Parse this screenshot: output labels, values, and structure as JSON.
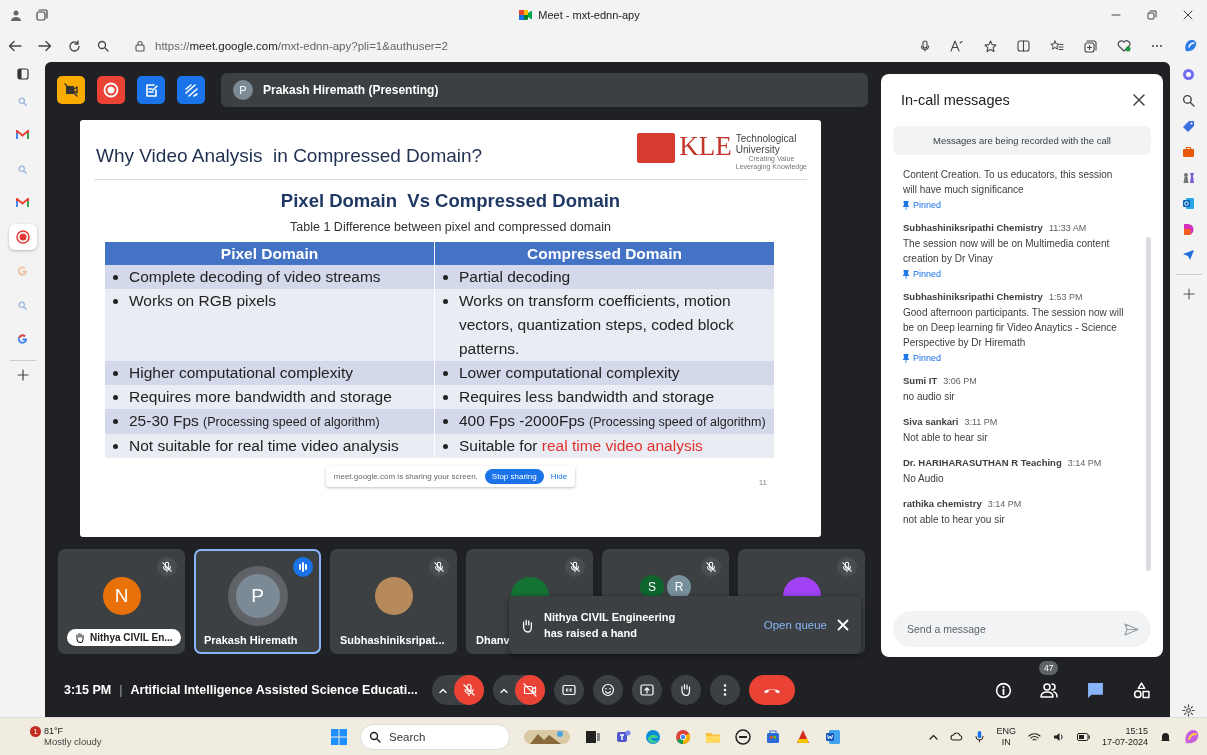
{
  "browser": {
    "window_title": "Meet - mxt-ednn-apy",
    "url": "https://**meet.google.com**/mxt-ednn-apy?pli=1&authuser=2",
    "vertical_tabs": [
      {
        "kind": "search",
        "selected": false
      },
      {
        "kind": "mail",
        "selected": false
      },
      {
        "kind": "search",
        "selected": false
      },
      {
        "kind": "mail",
        "selected": false
      },
      {
        "kind": "record",
        "selected": true
      },
      {
        "kind": "google-faded",
        "selected": false
      },
      {
        "kind": "search",
        "selected": false
      },
      {
        "kind": "google",
        "selected": false
      }
    ]
  },
  "meet": {
    "toolbar_buttons": [
      {
        "kind": "no-camera",
        "color": "#f9ab00"
      },
      {
        "kind": "record",
        "color": "#ea4335"
      },
      {
        "kind": "notes",
        "color": "#1a73e8"
      },
      {
        "kind": "whiteboard",
        "color": "#1a73e8"
      }
    ],
    "presenter": {
      "initial": "P",
      "label": "Prakash Hiremath (Presenting)"
    },
    "slide": {
      "title": "Why Video Analysis  in Compressed Domain?",
      "logo": {
        "name": "KLE",
        "line1": "Technological",
        "line2": "University",
        "tagline1": "Creating Value",
        "tagline2": "Leveraging Knowledge"
      },
      "heading": "Pixel Domain  Vs Compressed Domain",
      "caption": "Table 1 Difference between pixel and compressed domain",
      "columns": [
        "Pixel Domain",
        "Compressed Domain"
      ],
      "rows": [
        [
          {
            "text": "Complete decoding of video streams"
          },
          {
            "text": "Partial decoding"
          }
        ],
        [
          {
            "text": "Works on RGB pixels"
          },
          {
            "text": "Works on transform coefficients, motion vectors, quantization steps, coded block patterns."
          }
        ],
        [
          {
            "text": "Higher computational complexity"
          },
          {
            "text": "Lower computational complexity"
          }
        ],
        [
          {
            "text": "Requires more bandwidth and storage"
          },
          {
            "text": "Requires less bandwidth and storage"
          }
        ],
        [
          {
            "text": "25-30 Fps",
            "note": "(Processing speed of algorithm)"
          },
          {
            "text": "400 Fps -2000Fps",
            "note": "(Processing speed of algorithm)"
          }
        ],
        [
          {
            "text": "Not suitable for real time video analysis"
          },
          {
            "text": "Suitable for",
            "highlight": "real time video analysis"
          }
        ]
      ],
      "share_bar": {
        "message": "meet.google.com is sharing your screen.",
        "stop": "Stop sharing",
        "hide": "Hide"
      },
      "page_number": "11"
    },
    "tiles": [
      {
        "name": "Nithya CIVIL En...",
        "muted": true,
        "speaking": false,
        "selected": false,
        "hand_raised": true,
        "avatars": [
          {
            "kind": "letter",
            "letter": "N",
            "color": "#e8710a"
          }
        ]
      },
      {
        "name": "Prakash Hiremath",
        "muted": false,
        "speaking": true,
        "selected": true,
        "hand_raised": false,
        "avatars": [
          {
            "kind": "letter",
            "letter": "P",
            "color": "#7b8a95"
          }
        ]
      },
      {
        "name": "Subhashiniksripat...",
        "muted": true,
        "speaking": false,
        "selected": false,
        "hand_raised": false,
        "avatars": [
          {
            "kind": "photo"
          }
        ]
      },
      {
        "name": "Dhanv",
        "muted": true,
        "speaking": false,
        "selected": false,
        "hand_raised": false,
        "avatars": [
          {
            "kind": "letter",
            "color": "#137333"
          }
        ]
      },
      {
        "muted": true,
        "speaking": false,
        "selected": false,
        "hand_raised": false,
        "avatars": [
          {
            "kind": "letter",
            "letter": "S",
            "color": "#0d652d"
          },
          {
            "kind": "letter",
            "letter": "R",
            "color": "#78909c"
          }
        ]
      },
      {
        "muted": true,
        "speaking": false,
        "selected": false,
        "hand_raised": false,
        "avatars": [
          {
            "kind": "letter",
            "color": "#a142f4"
          }
        ]
      }
    ],
    "toast": {
      "text": "Nithya CIVIL Engineering has raised a hand",
      "action": "Open queue"
    },
    "chat": {
      "title": "In-call messages",
      "notice": "Messages are being recorded with the call",
      "messages": [
        {
          "text": "Content Creation. To us educators, this session will have much significance",
          "pin_label": "Pinned"
        },
        {
          "sender": "Subhashiniksripathi Chemistry",
          "time": "11:33 AM",
          "text": "The session now will be on Multimedia content creation by Dr Vinay",
          "pin_label": "Pinned"
        },
        {
          "sender": "Subhashiniksripathi Chemistry",
          "time": "1:53 PM",
          "text": "Good afternoon participants. The session now will be on Deep learning fir Video Anaytics - Science Perspective by Dr Hiremath",
          "pin_label": "Pinned"
        },
        {
          "sender": "Sumi IT",
          "time": "3:06 PM",
          "text": "no audio sir"
        },
        {
          "sender": "Siva sankari",
          "time": "3:11 PM",
          "text": "Not able to hear sir"
        },
        {
          "sender": "Dr. HARIHARASUTHAN R Teaching",
          "time": "3:14 PM",
          "text": "No Audio"
        },
        {
          "sender": "rathika chemistry",
          "time": "3:14 PM",
          "text": "not able to hear you sir"
        }
      ],
      "input": {
        "placeholder": "Send a message"
      }
    },
    "bottom_bar": {
      "time": "3:15 PM",
      "separator": "|",
      "title": "Artificial Intelligence Assisted Science Educati...",
      "controls": [
        {
          "kind": "mic",
          "off": true,
          "caret": true
        },
        {
          "kind": "camera",
          "off": true,
          "caret": true
        },
        {
          "kind": "captions",
          "off": false,
          "caret": false
        },
        {
          "kind": "emoji",
          "off": false,
          "caret": false
        },
        {
          "kind": "present",
          "off": false,
          "caret": false
        },
        {
          "kind": "hand",
          "off": false,
          "caret": false
        },
        {
          "kind": "more",
          "off": false,
          "caret": false
        },
        {
          "kind": "hangup",
          "off": true,
          "caret": false
        }
      ],
      "side_buttons": [
        {
          "kind": "info",
          "selected": false
        },
        {
          "kind": "people",
          "selected": false,
          "badge": "47"
        },
        {
          "kind": "chat",
          "selected": true
        },
        {
          "kind": "activities",
          "selected": false
        }
      ]
    }
  },
  "taskbar": {
    "weather": {
      "badge": "1",
      "temp": "81°F",
      "condition": "Mostly cloudy"
    },
    "search": {
      "placeholder": "Search"
    },
    "apps": [
      {
        "kind": "taskview"
      },
      {
        "kind": "teams"
      },
      {
        "kind": "edge"
      },
      {
        "kind": "chrome"
      },
      {
        "kind": "folder"
      },
      {
        "kind": "dell"
      },
      {
        "kind": "store"
      },
      {
        "kind": "game"
      },
      {
        "kind": "word"
      }
    ],
    "language": {
      "code": "ENG",
      "region": "IN"
    },
    "clock": {
      "time": "15:15",
      "date": "17-07-2024"
    }
  }
}
